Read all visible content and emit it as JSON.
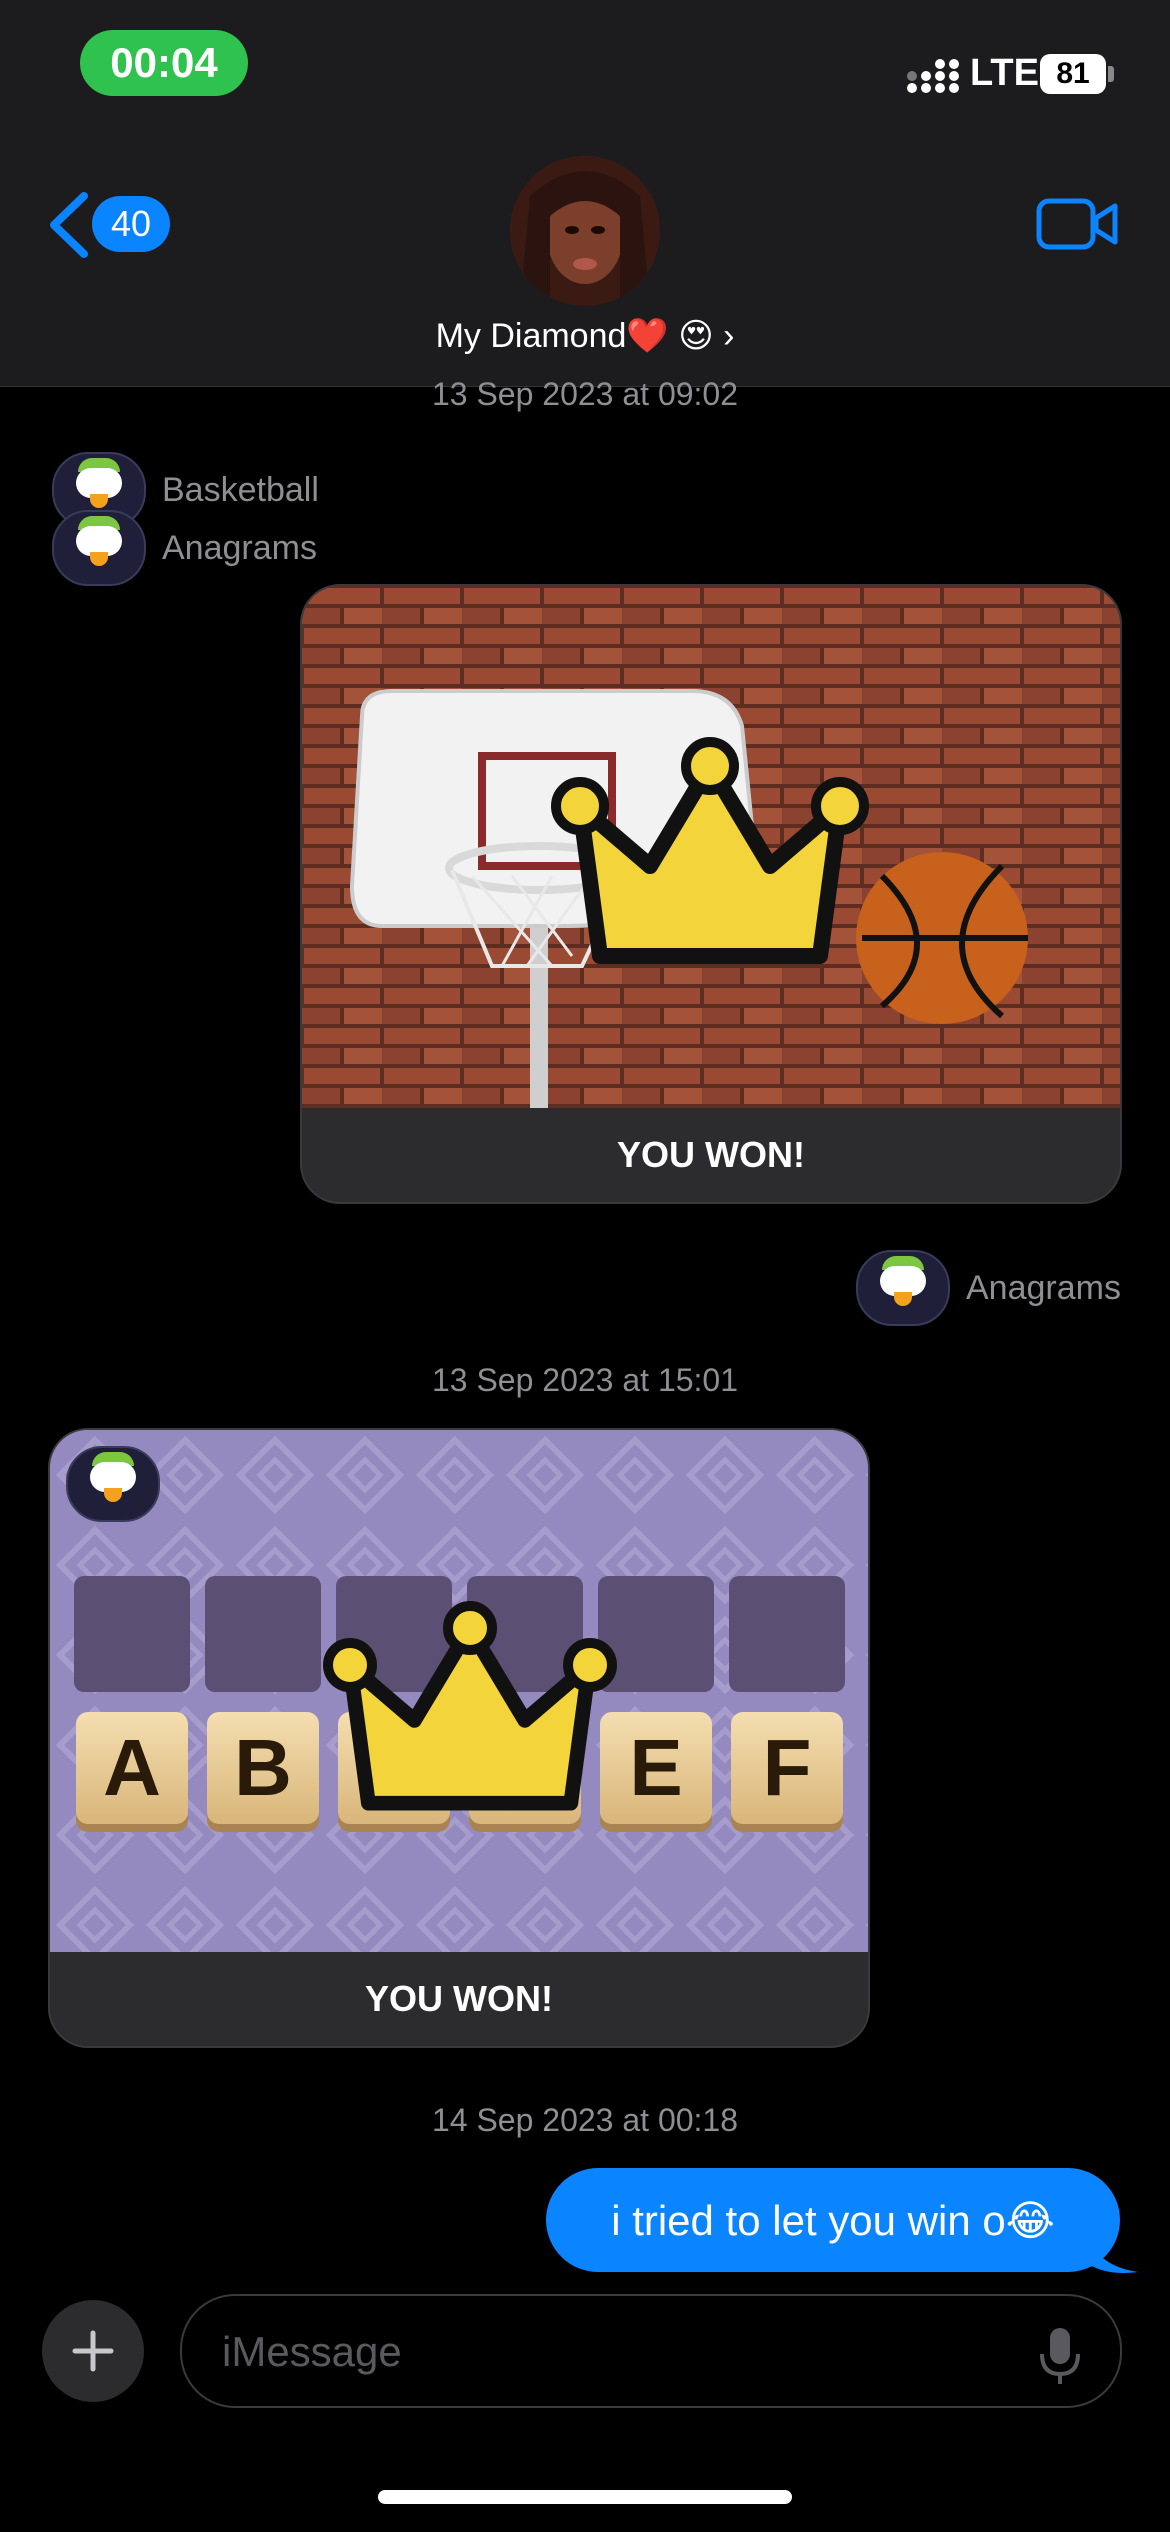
{
  "status_bar": {
    "time": "00:04",
    "network": "LTE",
    "battery": "81"
  },
  "header": {
    "back_count": "40",
    "contact_name": "My Diamond❤️ 😍 ›"
  },
  "messages": {
    "stamp_1": "13 Sep 2023 at 09:02",
    "label_basketball": "Basketball",
    "label_anagrams_1": "Anagrams",
    "card_basketball_caption": "YOU WON!",
    "label_anagrams_2": "Anagrams",
    "stamp_2": "13 Sep 2023 at 15:01",
    "card_anagrams_caption": "YOU WON!",
    "tiles": [
      "A",
      "B",
      "",
      "",
      "E",
      "F"
    ],
    "stamp_3": "14 Sep 2023 at 00:18",
    "bubble_text": "i tried to let you win o😂"
  },
  "composer": {
    "placeholder": "iMessage"
  },
  "colors": {
    "accent": "#0a84ff",
    "time_pill": "#30c24f",
    "header_bg": "#1c1c1e",
    "card_bg": "#2c2c2e"
  }
}
